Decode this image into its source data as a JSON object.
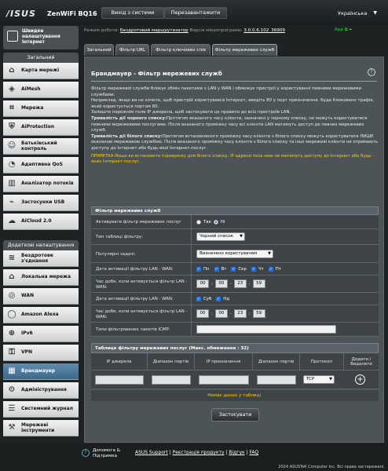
{
  "header": {
    "logo": "/ISUS",
    "model": "ZenWiFi BQ16",
    "logout": "Вихід з системи",
    "reboot": "Перезавантажити",
    "language": "Українська"
  },
  "status": {
    "mode_label": "Режим роботи:",
    "mode_value": "Бездротовий маршрутизатор",
    "fw_label": "Версія мікропрограми:",
    "fw_value": "3.0.0.6.102_36909",
    "app_label": "App"
  },
  "sidebar": {
    "quick_setup": "Швидке налаштування Інтернет",
    "general_title": "Загальний",
    "general_items": [
      {
        "label": "Карта мережі",
        "icon": "network-map-icon"
      },
      {
        "label": "AiMesh",
        "icon": "aimesh-icon"
      },
      {
        "label": "Мережа",
        "icon": "network-icon"
      },
      {
        "label": "AiProtection",
        "icon": "shield-icon"
      },
      {
        "label": "Батьківський контроль",
        "icon": "parental-control-icon"
      },
      {
        "label": "Адаптивна QoS",
        "icon": "qos-icon"
      },
      {
        "label": "Аналізатор потоків",
        "icon": "traffic-analyzer-icon"
      },
      {
        "label": "Застосунки USB",
        "icon": "usb-icon"
      },
      {
        "label": "AiCloud 2.0",
        "icon": "cloud-icon"
      }
    ],
    "advanced_title": "Додаткові налаштування",
    "advanced_items": [
      {
        "label": "Бездротове з'єднання",
        "icon": "wireless-icon"
      },
      {
        "label": "Локальна мережа",
        "icon": "lan-icon"
      },
      {
        "label": "WAN",
        "icon": "wan-icon"
      },
      {
        "label": "Amazon Alexa",
        "icon": "alexa-icon"
      },
      {
        "label": "IPv6",
        "icon": "ipv6-icon"
      },
      {
        "label": "VPN",
        "icon": "vpn-icon"
      },
      {
        "label": "Брандмауер",
        "icon": "firewall-icon"
      },
      {
        "label": "Адміністрування",
        "icon": "administration-icon"
      },
      {
        "label": "Системний журнал",
        "icon": "system-log-icon"
      },
      {
        "label": "Мережеві інструменти",
        "icon": "network-tools-icon"
      }
    ]
  },
  "tabs": [
    "Загальний",
    "Фільтр URL",
    "Фільтр ключових слів",
    "Фільтр мережевих служб"
  ],
  "page": {
    "title": "Брандмауер - Фільтр мережевих служб",
    "desc1": "Фільтр мережевої служби блокує обмін пакетами з LAN у WAN і обмежує пристрої у користуванні певними мережевими службами.",
    "desc2": "Наприклад, якщо ви не хочете, щоб пристрій користувався Інтернет, введіть 80 у порт призначення. Буде блоковано трафік, який користується портом 80.",
    "desc3": "Залиште порожнім поле IP джерела, щоб застосувати це правило до всіх пристроїв LAN.",
    "black_label": "Тривалість дії чорного списку:",
    "black_text": "Протягом вказаного часу клієнти, зазначені у чорному списку, не можуть користуватися певними мережевими послугами. Після вказаного проміжку часу всі клієнти LAN матимуть доступ до певних мережевих служб.",
    "white_label": "Тривалість дії білого списку:",
    "white_text": "Протягом встановленого проміжку часу клієнти з білого списку можуть користуватися ЛИШЕ вказаною мережевою службою. Після вказаного проміжку часу клієнти з білого списку та інші мережеві клієнти не отримають доступу до Інтернет або будь-якої Інтернет-послуг.",
    "note": "ПРИМІТКА:Якщо ви встановите підмережу для білого списку, IP-адреси поза нею не матимуть доступу до Інтернет або будь-яких Інтернет-послуг."
  },
  "form": {
    "header": "Фільтр мережевих служб",
    "enable_label": "Активувати фільтр мережевих послуг",
    "yes": "Так",
    "no": "Ні",
    "table_type_label": "Тип таблиці фільтру:",
    "table_type_value": "Чорний список",
    "popular_label": "Популярні задачі:",
    "popular_value": "Визначено користувачем",
    "date1_label": "Дата активації фільтру LAN - WAN:",
    "days1": [
      "Пн",
      "Вт",
      "Сер",
      "Чт",
      "Пт"
    ],
    "time1_label": "Час доби, коли активується фільтр LAN - WAN:",
    "time1": [
      "00",
      "00",
      "23",
      "59"
    ],
    "date2_label": "Дата активації фільтру LAN - WAN:",
    "days2": [
      "Суб",
      "Нд"
    ],
    "time2_label": "Час доби, коли активується фільтр LAN - WAN:",
    "time2": [
      "00",
      "00",
      "23",
      "59"
    ],
    "icmp_label": "Типи фільтрованих пакетів ICMP:",
    "icmp_value": ""
  },
  "rules_table": {
    "title": "Таблиця фільтру мережевих послуг (Макс. обмеження : 32)",
    "columns": [
      "IP джерела",
      "Діапазон портів",
      "IP призначення",
      "Діапазон портів",
      "Протокол",
      "Додати / Видалити"
    ],
    "protocol": "TCP",
    "empty": "Немає даних у таблиці."
  },
  "apply": "Застосувати",
  "footer": {
    "help": "Допомога & Підтримка",
    "links": [
      "ASUS Support",
      "Реєстрація продукту",
      "Відгук",
      "FAQ"
    ],
    "copyright": "2024 ASUSTeK Computer Inc. Всі права застережені."
  }
}
